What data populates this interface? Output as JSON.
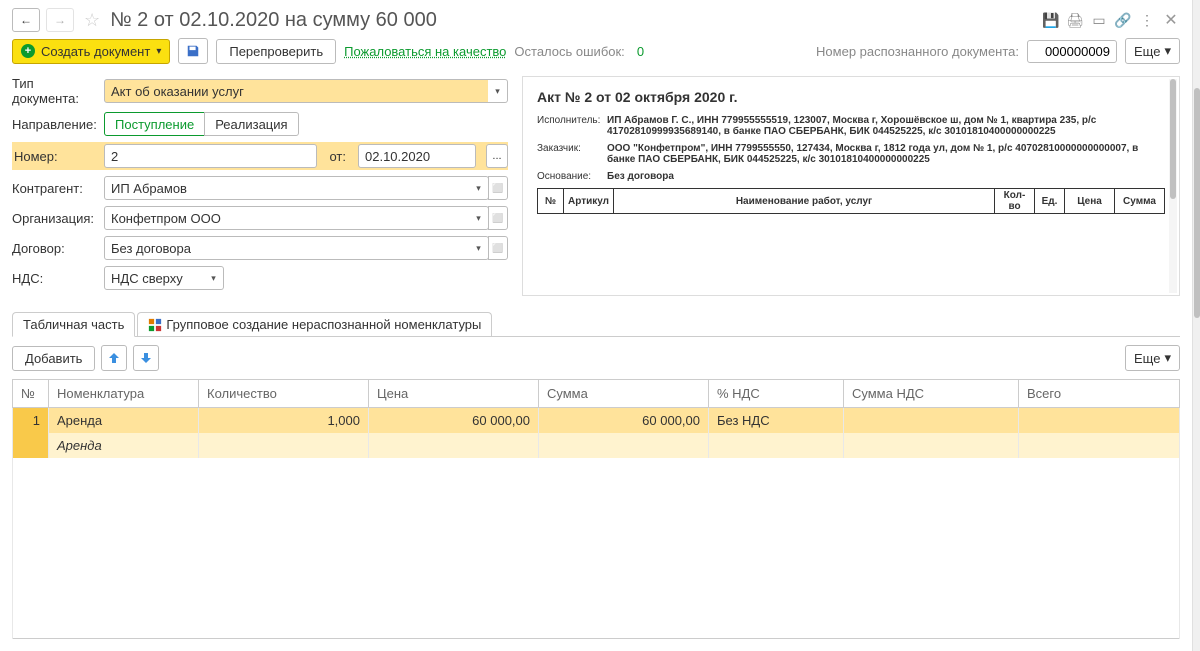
{
  "header": {
    "title": "№ 2 от 02.10.2020 на сумму 60 000"
  },
  "toolbar": {
    "create": "Создать документ",
    "recheck": "Перепроверить",
    "complain": "Пожаловаться на качество",
    "errors_left": "Осталось ошибок:",
    "errors_count": "0",
    "doc_num_label": "Номер распознанного документа:",
    "doc_num": "000000009",
    "more": "Еще"
  },
  "form": {
    "doc_type_label": "Тип документа:",
    "doc_type": "Акт об оказании услуг",
    "direction_label": "Направление:",
    "direction_in": "Поступление",
    "direction_out": "Реализация",
    "number_label": "Номер:",
    "number": "2",
    "date_label": "от:",
    "date": "02.10.2020",
    "counterparty_label": "Контрагент:",
    "counterparty": "ИП Абрамов",
    "org_label": "Организация:",
    "org": "Конфетпром ООО",
    "contract_label": "Договор:",
    "contract": "Без договора",
    "vat_label": "НДС:",
    "vat": "НДС сверху"
  },
  "preview": {
    "title": "Акт № 2 от 02 октября 2020 г.",
    "executor_label": "Исполнитель:",
    "executor": "ИП Абрамов Г. С., ИНН 779955555519, 123007, Москва г, Хорошёвское ш, дом № 1, квартира 235, р/с 41702810999935689140, в банке ПАО СБЕРБАНК, БИК 044525225, к/с 30101810400000000225",
    "customer_label": "Заказчик:",
    "customer": "ООО \"Конфетпром\", ИНН 7799555550, 127434, Москва г, 1812 года ул, дом № 1, р/с 40702810000000000007, в банке ПАО СБЕРБАНК, БИК 044525225, к/с 30101810400000000225",
    "basis_label": "Основание:",
    "basis": "Без договора",
    "cols": {
      "num": "№",
      "article": "Артикул",
      "name": "Наименование работ, услуг",
      "qty": "Кол-во",
      "unit": "Ед.",
      "price": "Цена",
      "sum": "Сумма"
    }
  },
  "tabs": {
    "tab1": "Табличная часть",
    "tab2": "Групповое создание нераспознанной номенклатуры"
  },
  "table": {
    "add": "Добавить",
    "more": "Еще",
    "cols": {
      "num": "№",
      "nomen": "Номенклатура",
      "qty": "Количество",
      "price": "Цена",
      "sum": "Сумма",
      "vat_rate": "% НДС",
      "vat_sum": "Сумма НДС",
      "total": "Всего"
    },
    "rows": [
      {
        "num": "1",
        "nomen": "Аренда",
        "qty": "1,000",
        "price": "60 000,00",
        "sum": "60 000,00",
        "vat_rate": "Без НДС",
        "vat_sum": "",
        "total": ""
      }
    ],
    "sub_nomen": "Аренда"
  }
}
